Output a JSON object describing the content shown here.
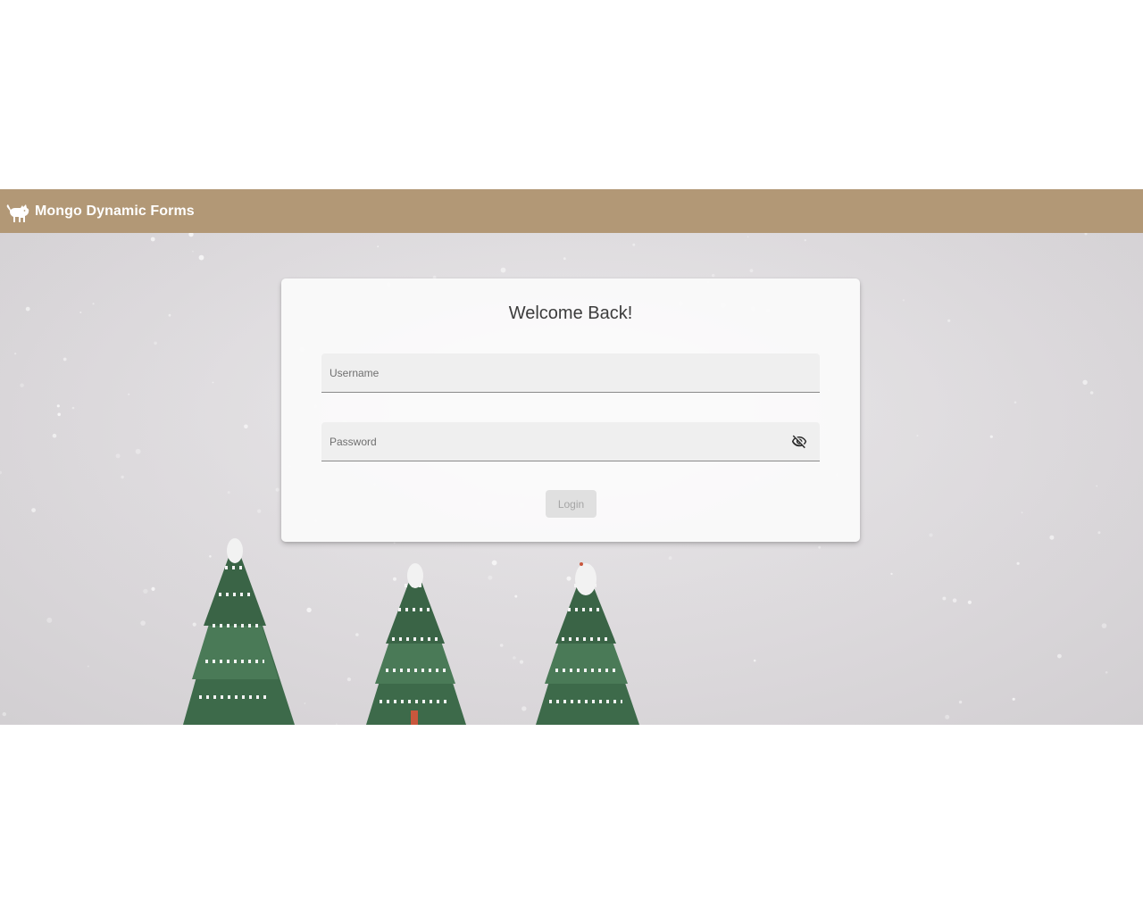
{
  "app": {
    "title": "Mongo Dynamic Forms",
    "logo_icon": "cat-icon",
    "bar_color": "#b29876"
  },
  "login": {
    "heading": "Welcome Back!",
    "username_placeholder": "Username",
    "username_value": "",
    "password_placeholder": "Password",
    "password_value": "",
    "visibility_icon": "visibility-off-icon",
    "submit_label": "Login",
    "submit_disabled": true
  },
  "background": {
    "description_icon": "christmas-trees-snow",
    "tree_color": "#3c6b49"
  }
}
